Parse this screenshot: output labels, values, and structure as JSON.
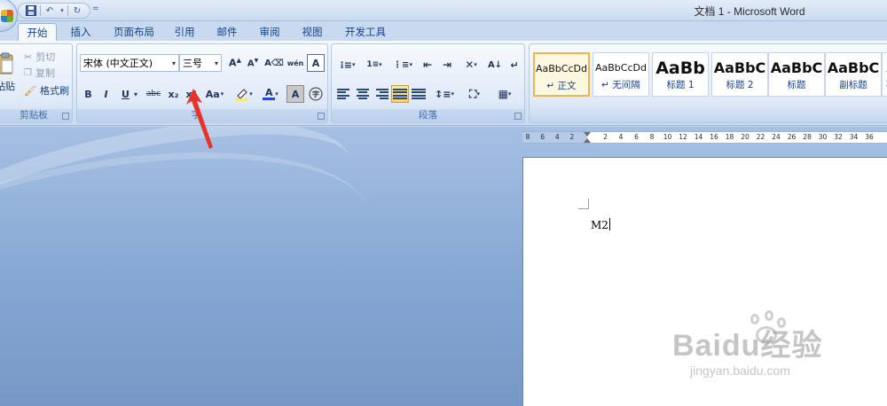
{
  "window": {
    "title": "文档 1 - Microsoft Word"
  },
  "qat": {
    "icons": [
      "save-icon",
      "undo-icon",
      "redo-icon"
    ]
  },
  "tabs": [
    "开始",
    "插入",
    "页面布局",
    "引用",
    "邮件",
    "审阅",
    "视图",
    "开发工具"
  ],
  "clipboard": {
    "paste": "粘贴",
    "cut": "剪切",
    "copy": "复制",
    "format_painter": "格式刷",
    "group_label": "剪贴板"
  },
  "font": {
    "font_name": "宋体 (中文正文)",
    "font_size": "三号",
    "group_label": "字体",
    "group_label_visible": "字",
    "buttons": {
      "bold": "B",
      "italic": "I",
      "underline": "U",
      "strike": "abc",
      "subscript": "x₂",
      "superscript": "x²",
      "change_case": "Aa"
    }
  },
  "paragraph": {
    "group_label": "段落"
  },
  "styles": {
    "items": [
      {
        "sample": "AaBbCcDd",
        "name": "↵ 正文"
      },
      {
        "sample": "AaBbCcDd",
        "name": "↵ 无间隔"
      },
      {
        "sample": "AaBb",
        "name": "标题 1"
      },
      {
        "sample": "AaBbC",
        "name": "标题 2"
      },
      {
        "sample": "AaBbC",
        "name": "标题"
      },
      {
        "sample": "AaBbC",
        "name": "副标题"
      },
      {
        "sample": "A",
        "name": "不"
      }
    ]
  },
  "ruler": {
    "ticks": [
      "8",
      "6",
      "4",
      "2",
      "",
      "2",
      "4",
      "6",
      "8",
      "10",
      "12",
      "14",
      "16",
      "18",
      "20",
      "22",
      "24",
      "26",
      "28",
      "30",
      "32",
      "34",
      "36"
    ]
  },
  "document": {
    "text": "M2"
  },
  "watermark": {
    "brand": "Baidu经验",
    "url": "jingyan.baidu.com"
  },
  "colors": {
    "annotation_arrow": "#e8332a",
    "highlight": "#ffd35e",
    "selected_style_border": "#f1b44a"
  }
}
